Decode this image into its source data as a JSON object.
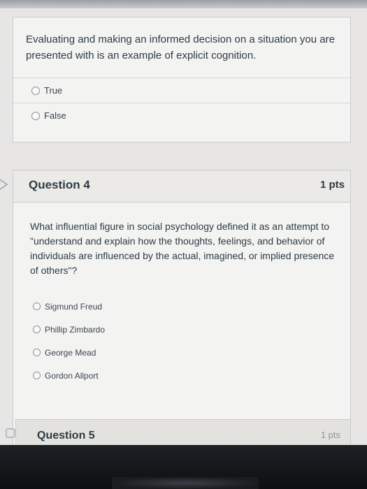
{
  "previous_question": {
    "text": "Evaluating and making an informed decision on a situation you are presented with is an example of explicit cognition.",
    "answers": [
      "True",
      "False"
    ]
  },
  "question4": {
    "title": "Question 4",
    "points": "1 pts",
    "text": "What influential figure in social psychology defined it as an attempt to \"understand and explain how the thoughts, feelings, and behavior of individuals are influenced by the actual, imagined, or implied presence of others\"?",
    "answers": [
      "Sigmund Freud",
      "Phillip Zimbardo",
      "George Mead",
      "Gordon Allport"
    ]
  },
  "question5": {
    "title": "Question 5",
    "points": "1 pts"
  }
}
